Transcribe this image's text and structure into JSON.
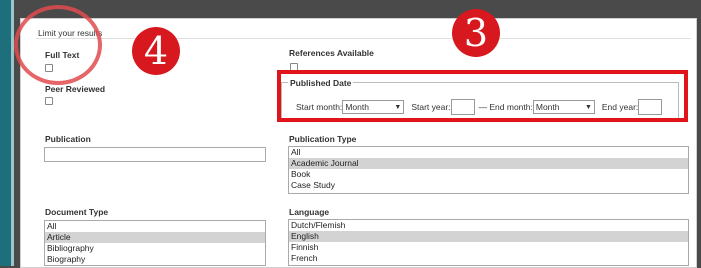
{
  "limit_results": {
    "title": "Limit your results",
    "full_text_label": "Full Text",
    "references_label": "References Available",
    "peer_reviewed_label": "Peer Reviewed",
    "publication_label": "Publication",
    "publication_value": "",
    "publication_type": {
      "label": "Publication Type",
      "options": [
        "All",
        "Academic Journal",
        "Book",
        "Case Study"
      ],
      "selected": "Academic Journal"
    },
    "published_date": {
      "legend": "Published Date",
      "start_month_label": "Start month:",
      "start_month_value": "Month",
      "start_year_label": "Start year:",
      "end_month_label": "— End month:",
      "end_month_value": "Month",
      "end_year_label": "End year:"
    },
    "document_type": {
      "label": "Document Type",
      "options": [
        "All",
        "Article",
        "Bibliography",
        "Biography"
      ],
      "selected": "Article"
    },
    "language": {
      "label": "Language",
      "options": [
        "Dutch/Flemish",
        "English",
        "Finnish",
        "French"
      ],
      "selected": "English"
    }
  },
  "annotations": {
    "badge_3": "3",
    "badge_4": "4",
    "accent_red": "#d7191f"
  }
}
